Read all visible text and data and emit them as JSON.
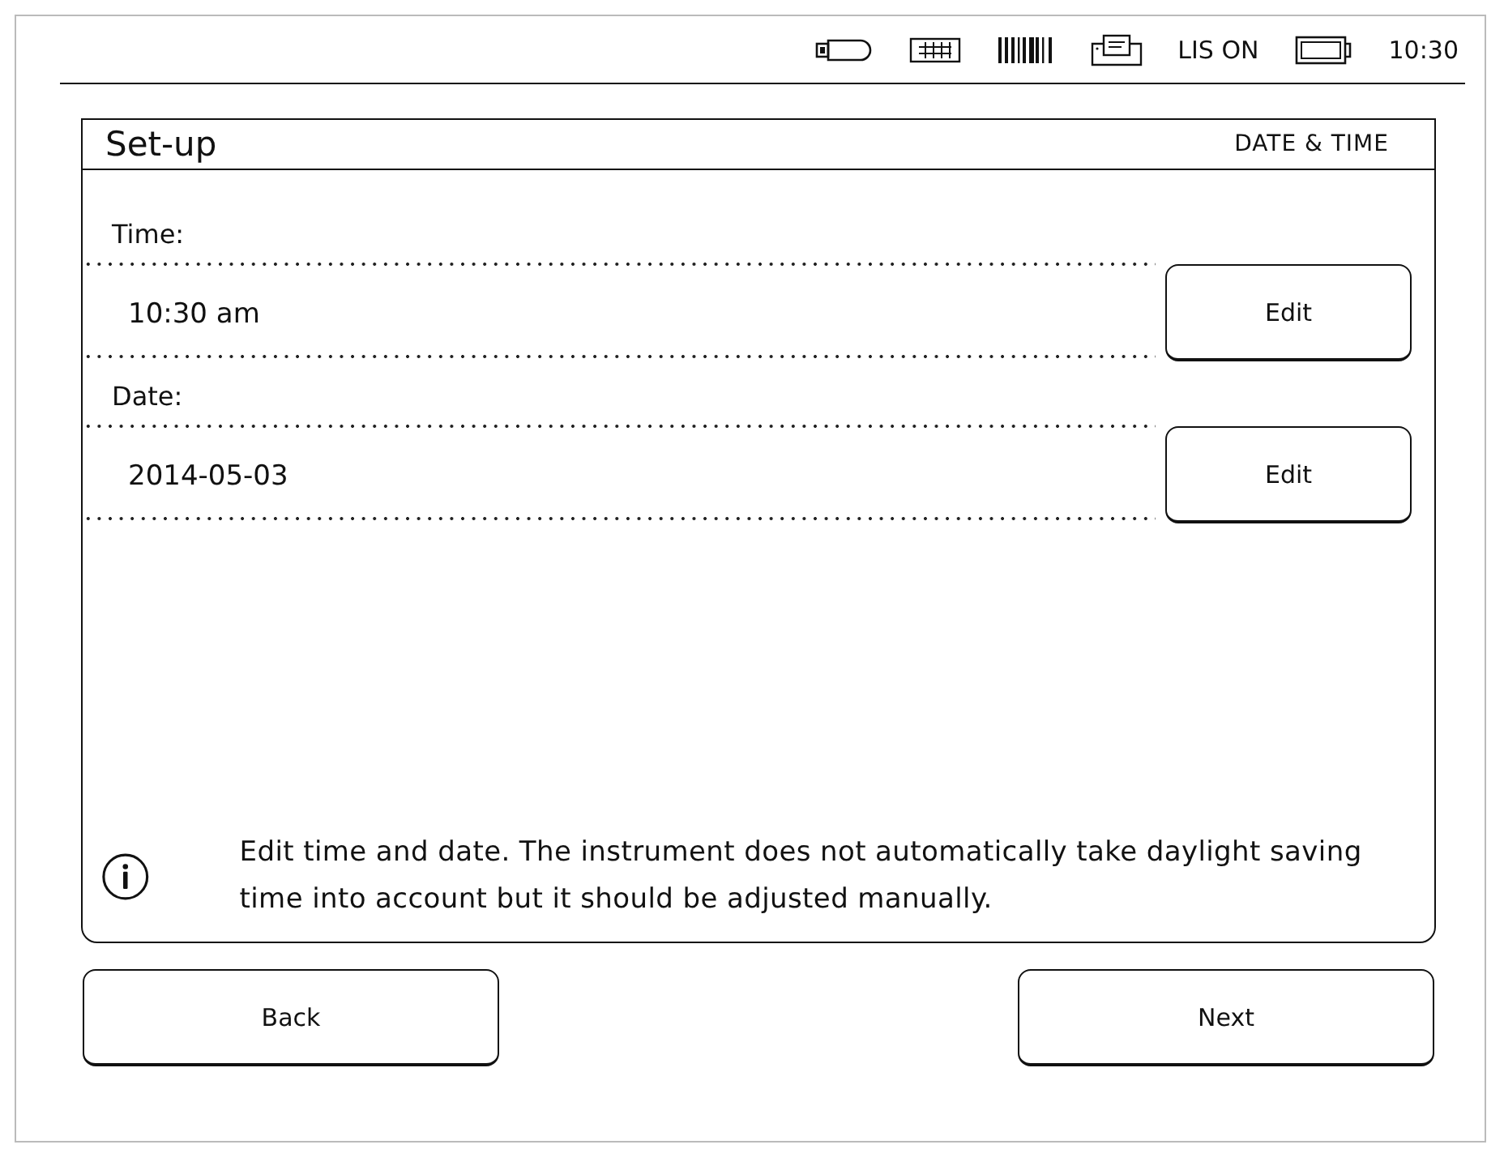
{
  "status_bar": {
    "indicators": [
      "LIS ON"
    ],
    "time": "10:30"
  },
  "panel": {
    "title": "Set-up",
    "section": "DATE & TIME"
  },
  "fields": [
    {
      "label": "Time:",
      "value": "10:30 am",
      "button": "Edit"
    },
    {
      "label": "Date:",
      "value": "2014-05-03",
      "button": "Edit"
    }
  ],
  "info": "Edit time and date. The instrument does not automatically take daylight saving time into account but it should be adjusted manually.",
  "buttons": [
    {
      "label": "Back"
    },
    {
      "label": "Next"
    }
  ]
}
